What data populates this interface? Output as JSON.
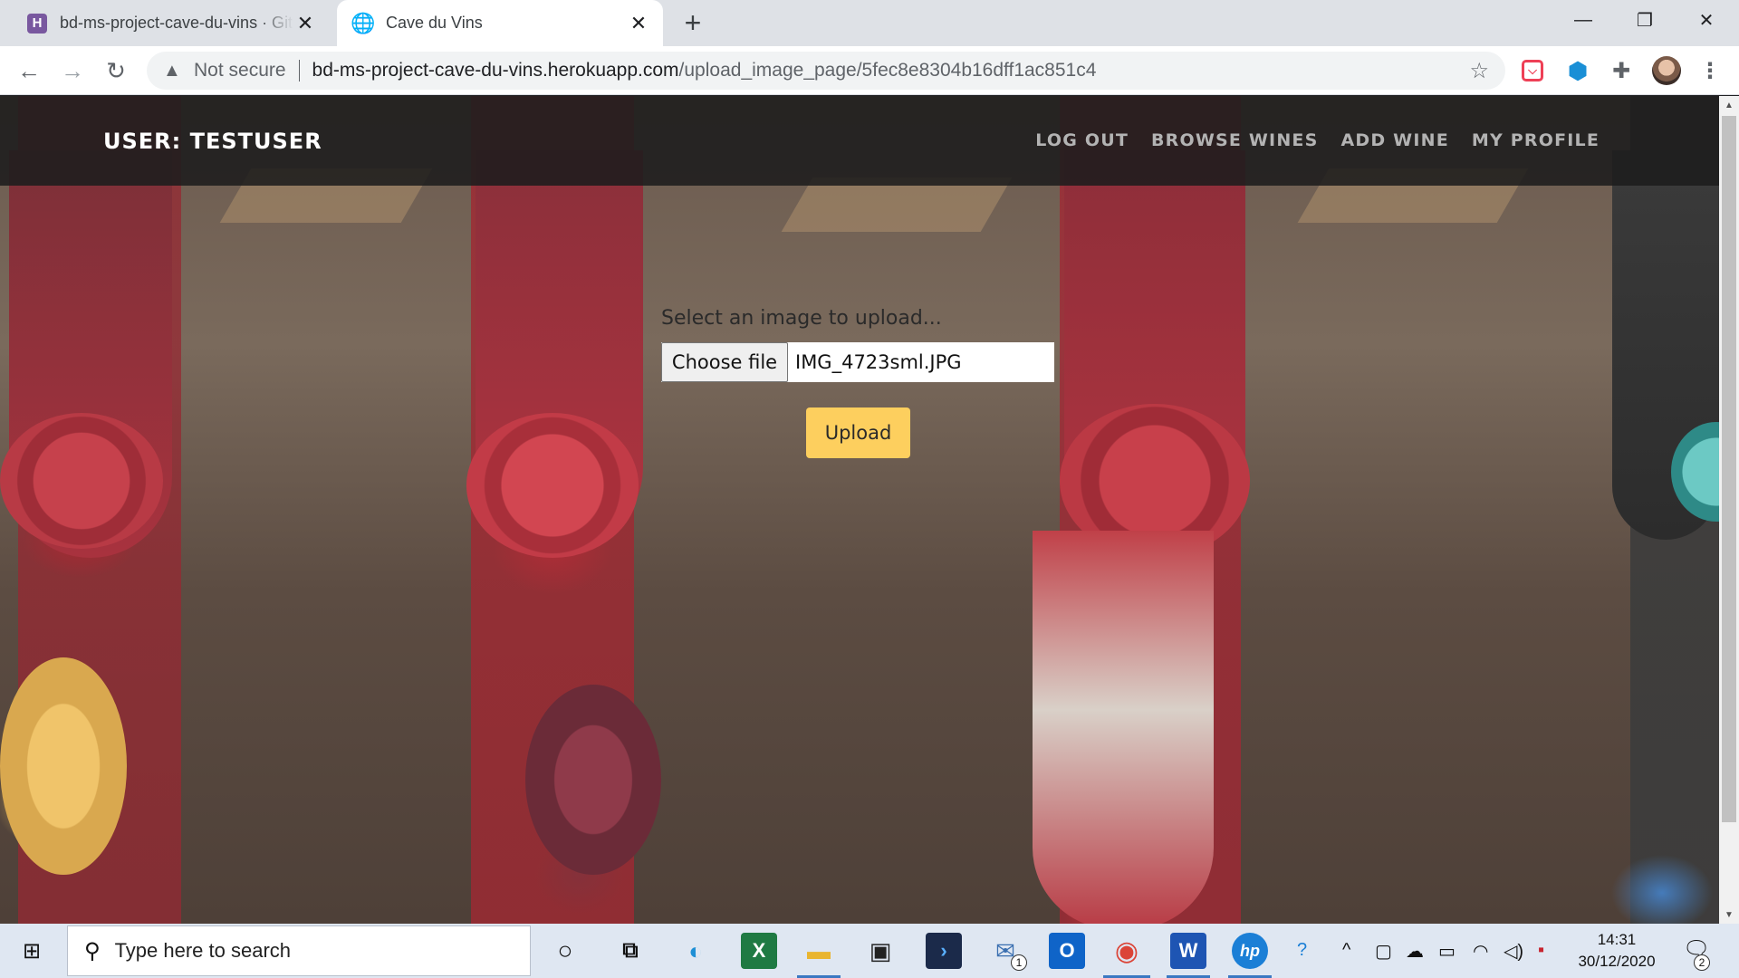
{
  "browser": {
    "tabs": [
      {
        "title": "bd-ms-project-cave-du-vins · Git",
        "favicon": "heroku-icon",
        "active": false
      },
      {
        "title": "Cave du Vins",
        "favicon": "globe-icon",
        "active": true
      }
    ],
    "new_tab": "+",
    "window_controls": {
      "minimize": "—",
      "restore": "❐",
      "close": "✕"
    },
    "address": {
      "security_label": "Not secure",
      "host": "bd-ms-project-cave-du-vins.herokuapp.com",
      "path": "/upload_image_page/5fec8e8304b16dff1ac851c4"
    }
  },
  "navbar": {
    "brand": "USER: TESTUSER",
    "links": [
      "LOG OUT",
      "BROWSE WINES",
      "ADD WINE",
      "MY PROFILE"
    ]
  },
  "upload": {
    "prompt": "Select an image to upload...",
    "choose_label": "Choose file",
    "file_name": "IMG_4723sml.JPG",
    "button_label": "Upload"
  },
  "taskbar": {
    "search_placeholder": "Type here to search",
    "time": "14:31",
    "date": "30/12/2020",
    "mail_badge": "1",
    "notification_badge": "2",
    "accent_color": "#fdcf5e"
  }
}
